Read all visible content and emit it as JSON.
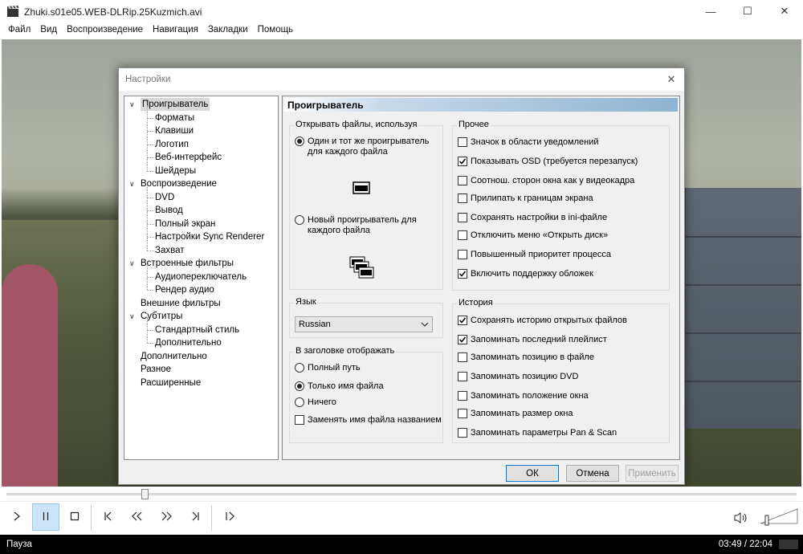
{
  "window": {
    "title": "Zhuki.s01e05.WEB-DLRip.25Kuzmich.avi",
    "minimize_glyph": "—",
    "maximize_glyph": "☐",
    "close_glyph": "✕"
  },
  "menu": [
    "Файл",
    "Вид",
    "Воспроизведение",
    "Навигация",
    "Закладки",
    "Помощь"
  ],
  "dialog": {
    "title": "Настройки",
    "close_glyph": "✕",
    "tree": [
      {
        "label": "Проигрыватель",
        "level": 0,
        "expandable": true,
        "selected": true
      },
      {
        "label": "Форматы",
        "level": 1
      },
      {
        "label": "Клавиши",
        "level": 1
      },
      {
        "label": "Логотип",
        "level": 1
      },
      {
        "label": "Веб-интерфейс",
        "level": 1
      },
      {
        "label": "Шейдеры",
        "level": 1
      },
      {
        "label": "Воспроизведение",
        "level": 0,
        "expandable": true
      },
      {
        "label": "DVD",
        "level": 1
      },
      {
        "label": "Вывод",
        "level": 1
      },
      {
        "label": "Полный экран",
        "level": 1
      },
      {
        "label": "Настройки Sync Renderer",
        "level": 1
      },
      {
        "label": "Захват",
        "level": 1
      },
      {
        "label": "Встроенные фильтры",
        "level": 0,
        "expandable": true
      },
      {
        "label": "Аудиопереключатель",
        "level": 1
      },
      {
        "label": "Рендер аудио",
        "level": 1
      },
      {
        "label": "Внешние фильтры",
        "level": 0
      },
      {
        "label": "Субтитры",
        "level": 0,
        "expandable": true
      },
      {
        "label": "Стандартный стиль",
        "level": 1
      },
      {
        "label": "Дополнительно",
        "level": 1
      },
      {
        "label": "Дополнительно",
        "level": 0
      },
      {
        "label": "Разное",
        "level": 0
      },
      {
        "label": "Расширенные",
        "level": 0
      }
    ],
    "panel_title": "Проигрыватель",
    "open_files": {
      "label": "Открывать файлы, используя",
      "options": [
        {
          "label": "Один и тот же проигрыватель для каждого файла",
          "selected": true
        },
        {
          "label": "Новый проигрыватель для каждого файла",
          "selected": false
        }
      ]
    },
    "misc": {
      "label": "Прочее",
      "options": [
        {
          "label": "Значок в области уведомлений",
          "checked": false
        },
        {
          "label": "Показывать OSD (требуется перезапуск)",
          "checked": true
        },
        {
          "label": "Соотнош. сторон окна как у видеокадра",
          "checked": false
        },
        {
          "label": "Прилипать к границам экрана",
          "checked": false
        },
        {
          "label": "Сохранять настройки в ini-файле",
          "checked": false
        },
        {
          "label": "Отключить меню «Открыть диск»",
          "checked": false
        },
        {
          "label": "Повышенный приоритет процесса",
          "checked": false
        },
        {
          "label": "Включить поддержку обложек",
          "checked": true
        }
      ]
    },
    "language": {
      "label": "Язык",
      "value": "Russian"
    },
    "title_display": {
      "label": "В заголовке отображать",
      "options": [
        {
          "label": "Полный путь",
          "selected": false
        },
        {
          "label": "Только имя файла",
          "selected": true
        },
        {
          "label": "Ничего",
          "selected": false
        }
      ],
      "replace_name": {
        "label": "Заменять имя файла названием",
        "checked": false
      }
    },
    "history": {
      "label": "История",
      "options": [
        {
          "label": "Сохранять историю открытых файлов",
          "checked": true
        },
        {
          "label": "Запоминать последний плейлист",
          "checked": true
        },
        {
          "label": "Запоминать позицию в файле",
          "checked": false
        },
        {
          "label": "Запоминать позицию DVD",
          "checked": false
        },
        {
          "label": "Запоминать положение окна",
          "checked": false
        },
        {
          "label": "Запоминать размер окна",
          "checked": false
        },
        {
          "label": "Запоминать параметры Pan & Scan",
          "checked": false
        }
      ]
    },
    "buttons": {
      "ok": "ОК",
      "cancel": "Отмена",
      "apply": "Применить"
    }
  },
  "playback": {
    "progress": 0.175
  },
  "status": {
    "state": "Пауза",
    "time": "03:49 / 22:04"
  }
}
